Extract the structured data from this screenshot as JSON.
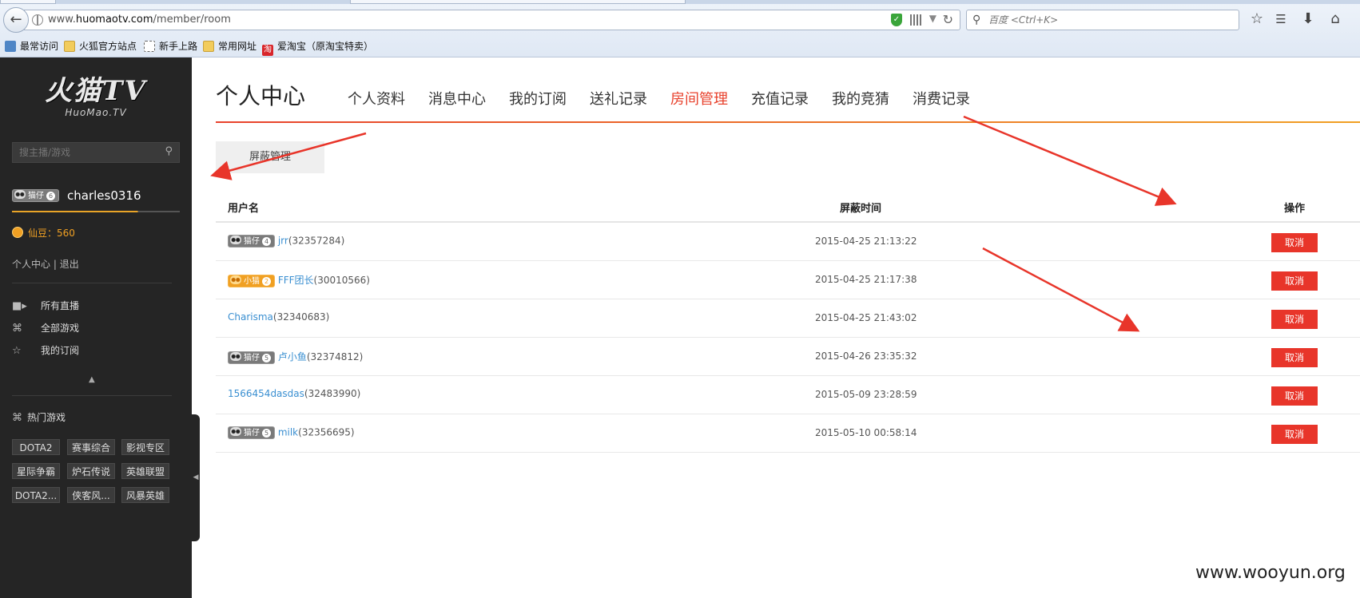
{
  "browser": {
    "url_prefix": "www.",
    "url_host": "huomaotv.com",
    "url_path": "/member/room",
    "search_placeholder": "百度 <Ctrl+K>",
    "bookmarks": [
      {
        "label": "最常访问",
        "icon": "bookmark-icon"
      },
      {
        "label": "火狐官方站点",
        "icon": "folder-icon"
      },
      {
        "label": "新手上路",
        "icon": "page-icon"
      },
      {
        "label": "常用网址",
        "icon": "folder-icon"
      },
      {
        "label": "爱淘宝（原淘宝特卖）",
        "icon": "taobao-icon",
        "icon_text": "淘"
      }
    ]
  },
  "sidebar": {
    "logo_main": "火猫TV",
    "logo_sub": "HuoMao.TV",
    "search_placeholder": "搜主播/游戏",
    "user": {
      "badge": "猫仔",
      "level": "6",
      "name": "charles0316"
    },
    "coins_label": "仙豆：560",
    "account_link": "个人中心",
    "separator": "|",
    "logout_link": "退出",
    "nav": [
      {
        "label": "所有直播",
        "icon": "camera-icon"
      },
      {
        "label": "全部游戏",
        "icon": "gamepad-icon"
      },
      {
        "label": "我的订阅",
        "icon": "star-icon"
      }
    ],
    "hot_games_title": "热门游戏",
    "games": [
      "DOTA2",
      "赛事综合",
      "影视专区",
      "星际争霸",
      "炉石传说",
      "英雄联盟",
      "DOTA2...",
      "侠客风...",
      "风暴英雄"
    ]
  },
  "main": {
    "title": "个人中心",
    "tabs": [
      {
        "label": "个人资料",
        "active": false
      },
      {
        "label": "消息中心",
        "active": false
      },
      {
        "label": "我的订阅",
        "active": false
      },
      {
        "label": "送礼记录",
        "active": false
      },
      {
        "label": "房间管理",
        "active": true
      },
      {
        "label": "充值记录",
        "active": false
      },
      {
        "label": "我的竞猜",
        "active": false
      },
      {
        "label": "消费记录",
        "active": false
      }
    ],
    "subtab": "屏蔽管理",
    "table": {
      "headers": {
        "user": "用户名",
        "time": "屏蔽时间",
        "action": "操作"
      },
      "rows": [
        {
          "badge": "猫仔",
          "level": "4",
          "badge_color": "gray",
          "name": "jrr",
          "uid": "(32357284)",
          "time": "2015-04-25 21:13:22",
          "action": "取消"
        },
        {
          "badge": "小猫",
          "level": "2",
          "badge_color": "orange",
          "name": "FFF团长",
          "uid": "(30010566)",
          "time": "2015-04-25 21:17:38",
          "action": "取消"
        },
        {
          "badge": "",
          "level": "",
          "badge_color": "",
          "name": "Charisma",
          "uid": "(32340683)",
          "time": "2015-04-25 21:43:02",
          "action": "取消"
        },
        {
          "badge": "猫仔",
          "level": "5",
          "badge_color": "gray",
          "name": "卢小鱼",
          "uid": "(32374812)",
          "time": "2015-04-26 23:35:32",
          "action": "取消"
        },
        {
          "badge": "",
          "level": "",
          "badge_color": "",
          "name": "1566454dasdas",
          "uid": "(32483990)",
          "time": "2015-05-09 23:28:59",
          "action": "取消"
        },
        {
          "badge": "猫仔",
          "level": "5",
          "badge_color": "gray",
          "name": "milk",
          "uid": "(32356695)",
          "time": "2015-05-10 00:58:14",
          "action": "取消"
        }
      ]
    }
  },
  "watermark": "www.wooyun.org",
  "colors": {
    "accent_red": "#e8412c",
    "accent_orange": "#f0a023",
    "sidebar_bg": "#252525",
    "link_blue": "#3a8fd1"
  }
}
